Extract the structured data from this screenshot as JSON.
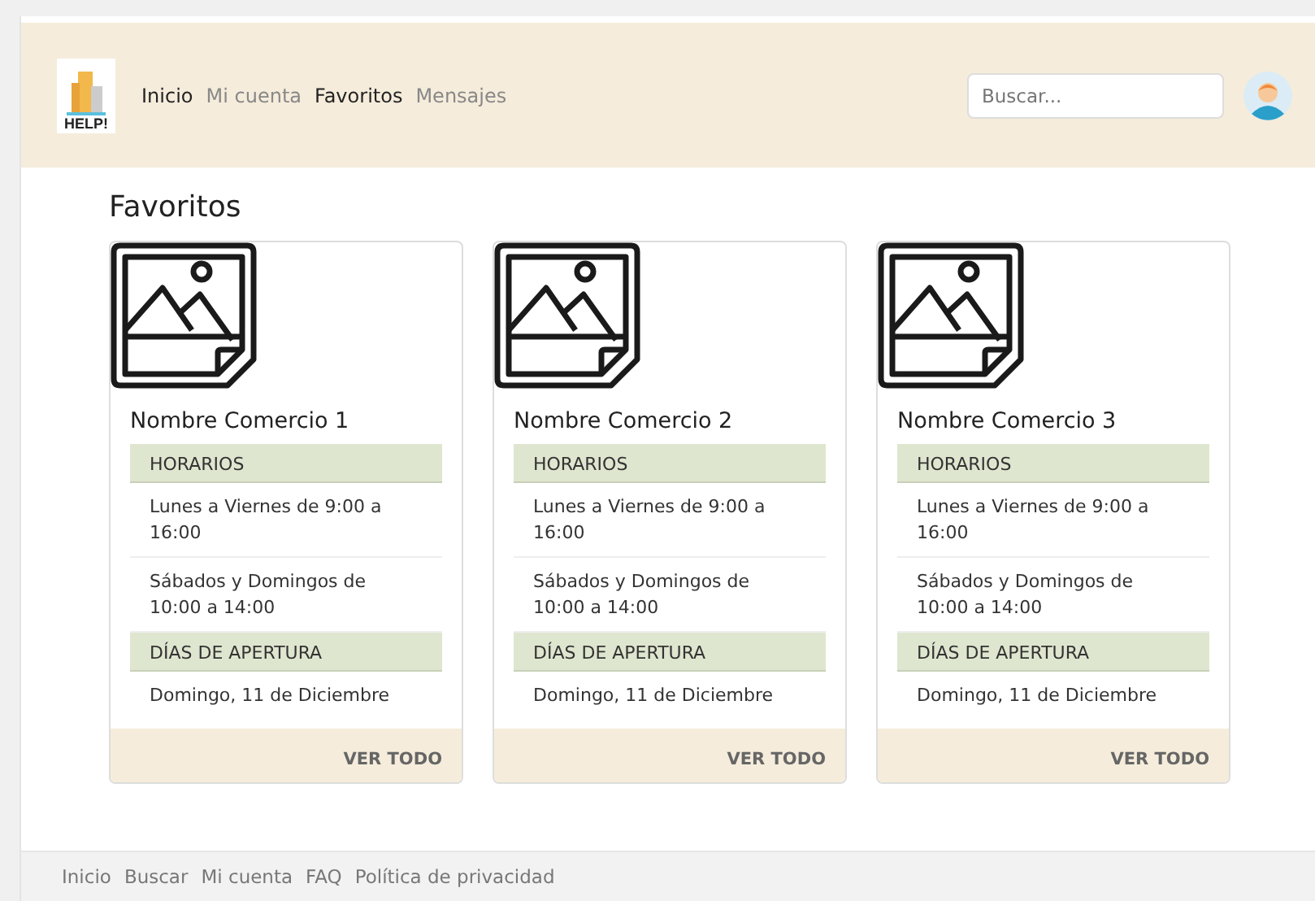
{
  "header": {
    "logo_text": "HELP!",
    "nav": [
      {
        "label": "Inicio",
        "active": true
      },
      {
        "label": "Mi cuenta",
        "active": false
      },
      {
        "label": "Favoritos",
        "active": true
      },
      {
        "label": "Mensajes",
        "active": false
      }
    ],
    "search": {
      "placeholder": "Buscar..."
    }
  },
  "page_title": "Favoritos",
  "cards": [
    {
      "title": "Nombre Comercio 1",
      "sections": [
        {
          "heading": "HORARIOS",
          "items": [
            "Lunes a Viernes de 9:00 a 16:00",
            "Sábados y Domingos de 10:00 a 14:00"
          ]
        },
        {
          "heading": "DÍAS DE APERTURA",
          "items": [
            "Domingo, 11 de Diciembre"
          ]
        }
      ],
      "link": "VER TODO"
    },
    {
      "title": "Nombre Comercio 2",
      "sections": [
        {
          "heading": "HORARIOS",
          "items": [
            "Lunes a Viernes de 9:00 a 16:00",
            "Sábados y Domingos de 10:00 a 14:00"
          ]
        },
        {
          "heading": "DÍAS DE APERTURA",
          "items": [
            "Domingo, 11 de Diciembre"
          ]
        }
      ],
      "link": "VER TODO"
    },
    {
      "title": "Nombre Comercio 3",
      "sections": [
        {
          "heading": "HORARIOS",
          "items": [
            "Lunes a Viernes de 9:00 a 16:00",
            "Sábados y Domingos de 10:00 a 14:00"
          ]
        },
        {
          "heading": "DÍAS DE APERTURA",
          "items": [
            "Domingo, 11 de Diciembre"
          ]
        }
      ],
      "link": "VER TODO"
    }
  ],
  "footer": {
    "links": [
      "Inicio",
      "Buscar",
      "Mi cuenta",
      "FAQ",
      "Política de privacidad"
    ]
  }
}
